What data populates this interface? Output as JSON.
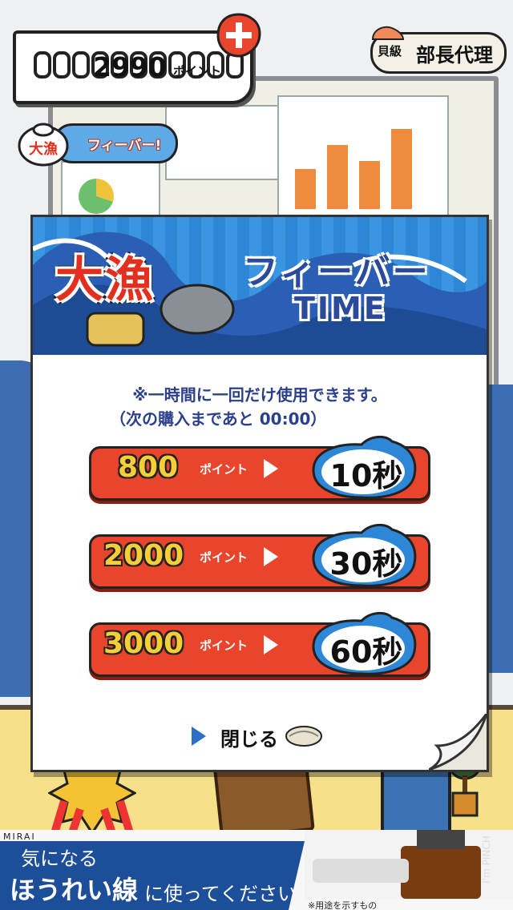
{
  "hud": {
    "points_value": "2990",
    "points_unit": "ポイント",
    "rank_label": "貝級",
    "rank_title": "部長代理"
  },
  "fever_badge": {
    "icon_text": "大漁",
    "label": "フィーバー!"
  },
  "dialog": {
    "banner_kanji": "大漁",
    "banner_title": "フィーバー",
    "banner_subtitle": "TIME",
    "note_line1": "※一時間に一回だけ使用できます。",
    "note_line2": "（次の購入まであと 00:00）",
    "options": [
      {
        "cost": "800",
        "unit": "ポイント",
        "duration": "10秒"
      },
      {
        "cost": "2000",
        "unit": "ポイント",
        "duration": "30秒"
      },
      {
        "cost": "3000",
        "unit": "ポイント",
        "duration": "60秒"
      }
    ],
    "close_label": "閉じる"
  },
  "ad": {
    "brand": "MIRAI",
    "line1": "気になる",
    "line2": "ほうれい線",
    "line2b": "に使ってください",
    "note": "※用途を示すもの",
    "product": "I'm PINCH"
  },
  "colors": {
    "accent_red": "#e9452c",
    "banner_blue": "#2d87d6",
    "cost_yellow": "#f6cf38"
  }
}
